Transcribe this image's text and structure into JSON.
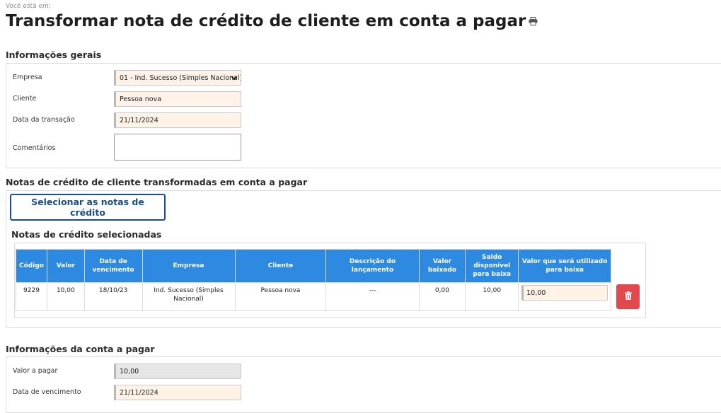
{
  "breadcrumb": "Você está em:",
  "page_title": "Transformar nota de crédito de cliente em conta a pagar",
  "general": {
    "title": "Informações gerais",
    "empresa_label": "Empresa",
    "empresa_value": "01 - Ind. Sucesso (Simples Nacional)",
    "cliente_label": "Cliente",
    "cliente_value": "Pessoa nova",
    "data_label": "Data da transação",
    "data_value": "21/11/2024",
    "comentarios_label": "Comentários",
    "comentarios_value": ""
  },
  "notes": {
    "title": "Notas de crédito de cliente transformadas em conta a pagar",
    "select_button": "Selecionar as notas de crédito",
    "selected_title": "Notas de crédito selecionadas",
    "columns": [
      "Código",
      "Valor",
      "Data de vencimento",
      "Empresa",
      "Cliente",
      "Descrição do lançamento",
      "Valor baixado",
      "Saldo disponível para baixa",
      "Valor que será utilizado para baixa"
    ],
    "rows": [
      {
        "codigo": "9229",
        "valor": "10,00",
        "vencimento": "18/10/23",
        "empresa": "Ind. Sucesso (Simples Nacional)",
        "cliente": "Pessoa nova",
        "descricao": "---",
        "valor_baixado": "0,00",
        "saldo": "10,00",
        "valor_utilizado": "10,00"
      }
    ]
  },
  "payable": {
    "title": "Informações da conta a pagar",
    "valor_label": "Valor a pagar",
    "valor_value": "10,00",
    "vencimento_label": "Data de vencimento",
    "vencimento_value": "21/11/2024"
  },
  "colors": {
    "accent_blue": "#1a4d8c",
    "header_blue": "#2d8ae0",
    "delete_red": "#e2484c",
    "required_field_bg": "#fff3e8",
    "readonly_field_bg": "#e6e6e6"
  }
}
